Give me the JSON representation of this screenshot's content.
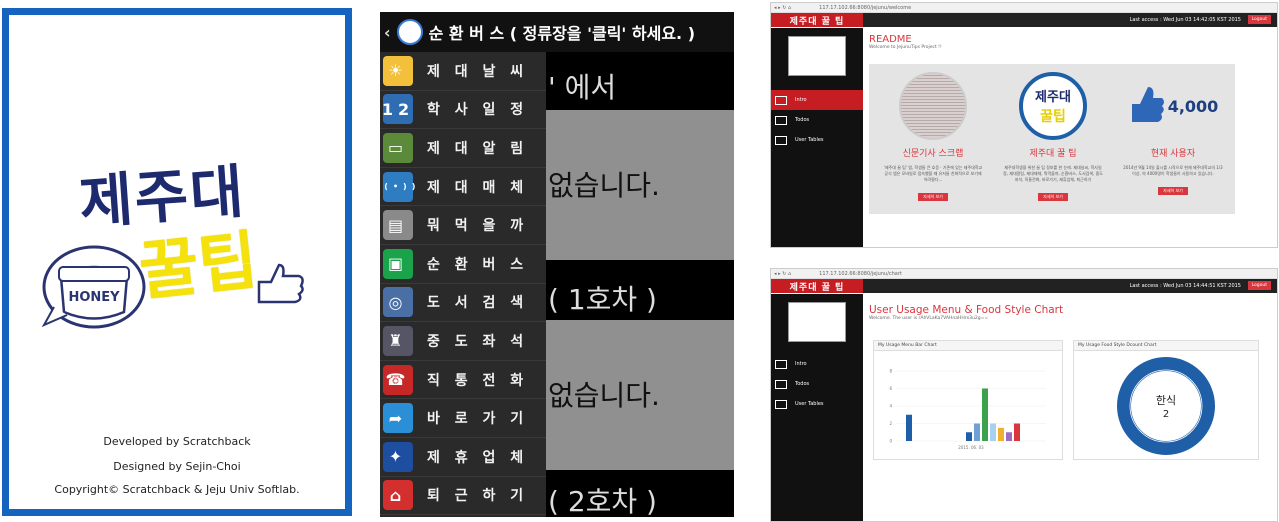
{
  "splash": {
    "title_line1": "제주대",
    "title_line2": "꿀팁",
    "pot_label": "HONEY",
    "developed_by": "Developed by Scratchback",
    "designed_by": "Designed by Sejin-Choi",
    "copyright": "Copyright© Scratchback & Jeju Univ Softlab."
  },
  "phone": {
    "back_glyph": "‹",
    "header_title": "순 환 버 스 ( 정류장을 '클릭' 하세요. )",
    "bg_texts": [
      "' 에서",
      "없습니다.",
      "( 1호차 )",
      "없습니다.",
      "( 2호차 )"
    ],
    "menu": [
      {
        "label": "제 대 날 씨",
        "icon": "weather-icon",
        "color": "#f3c03b",
        "glyph": "☀"
      },
      {
        "label": "학 사 일 정",
        "icon": "calendar-icon",
        "color": "#2f6db3",
        "glyph": "12"
      },
      {
        "label": "제 대 알 림",
        "icon": "board-icon",
        "color": "#5a8a3a",
        "glyph": "▭"
      },
      {
        "label": "제 대 매 체",
        "icon": "broadcast-icon",
        "color": "#2e7cc2",
        "glyph": "((•))"
      },
      {
        "label": "뭐 먹 을 까",
        "icon": "menu-icon",
        "color": "#8a8a8a",
        "glyph": "▤"
      },
      {
        "label": "순 환 버 스",
        "icon": "bus-icon",
        "color": "#1aa34a",
        "glyph": "▣"
      },
      {
        "label": "도 서 검 색",
        "icon": "search-icon",
        "color": "#4a6fa5",
        "glyph": "◎"
      },
      {
        "label": "중 도 좌 석",
        "icon": "chair-icon",
        "color": "#556",
        "glyph": "♜"
      },
      {
        "label": "직 통 전 화",
        "icon": "phone-icon",
        "color": "#c62828",
        "glyph": "☎"
      },
      {
        "label": "바 로 가 기",
        "icon": "shortcut-icon",
        "color": "#2a8fd6",
        "glyph": "➦"
      },
      {
        "label": "제 휴 업 체",
        "icon": "handshake-icon",
        "color": "#1e4ea0",
        "glyph": "✦"
      },
      {
        "label": "퇴 근 하 기",
        "icon": "home-icon",
        "color": "#d32f2f",
        "glyph": "⌂"
      }
    ]
  },
  "web1": {
    "url": "117.17.102.66:8080/jejunu/welcome",
    "brand": "제주대 꿀 팁",
    "last_access": "Last access : Wed Jun 03 14:42:05 KST 2015",
    "logout": "Logout",
    "nav": [
      "Intro",
      "Todos",
      "User Tables"
    ],
    "readme_title": "README",
    "readme_sub": "Welcome to JejunuTips Project !!",
    "cols": [
      {
        "heading": "신문기사 스크랩",
        "text": "'제주대 꿀 팁' 앱, 학생들 큰 호응 · 기존에 있는 제주대학교 공식 앱은 모바일로 접속했을 때 유저들 친화적으로 보기에 어려웠다...",
        "btn": "자세히 보기"
      },
      {
        "heading": "제주대 꿀 팁",
        "text": "제주대학생을 위한 꿀 팁 정보를 한 눈에. 제대날씨, 학사일정, 제대알림, 제대매체, 뭐먹을까, 순환버스, 도서검색, 중도좌석, 직통전화, 바로가기, 제휴업체, 퇴근하기",
        "btn": "자세히 보기"
      },
      {
        "heading": "현재 사용자",
        "text": "2014년 9월 14일 출시를 시작으로 현재 제주대학교의 1/3 이상, 약 4000명이 학생들이 사용하고 있습니다.",
        "btn": "자세히 보기"
      }
    ],
    "thumb_count": "4,000",
    "badge_line1": "제주대",
    "badge_line2": "꿀팁"
  },
  "web2": {
    "url": "117.17.102.66:8080/jejunu/chart",
    "brand": "제주대 꿀 팁",
    "last_access": "Last access : Wed Jun 03 14:44:51 KST 2015",
    "logout": "Logout",
    "nav": [
      "Intro",
      "Todos",
      "User Tables"
    ],
    "title": "User Usage Menu & Food Style Chart",
    "subtitle": "Welcome. The user is rAhVLaKa7VAHnaHHrx3u2g==",
    "bar_card_title": "My Usage Menu Bar Chart",
    "donut_card_title": "My Usage Food Style Dcount Chart",
    "donut_label": "한식",
    "donut_value": "2",
    "x_label": "2015. 06. 03"
  },
  "chart_data": [
    {
      "type": "bar",
      "title": "My Usage Menu Bar Chart",
      "yticks": [
        0,
        2,
        4,
        6,
        8
      ],
      "ylim": [
        0,
        8
      ],
      "x": "2015. 06. 03",
      "series": [
        {
          "values": [
            3
          ],
          "color": "#1f5fa8"
        },
        {
          "values": [
            1
          ],
          "color": "#1f5fa8"
        },
        {
          "values": [
            2
          ],
          "color": "#6fa0d8"
        },
        {
          "values": [
            6
          ],
          "color": "#3aa24a"
        },
        {
          "values": [
            2
          ],
          "color": "#a9d1ef"
        },
        {
          "values": [
            1.5
          ],
          "color": "#f0b030"
        },
        {
          "values": [
            1
          ],
          "color": "#9a6cc2"
        },
        {
          "values": [
            2
          ],
          "color": "#d9363e"
        }
      ]
    },
    {
      "type": "pie",
      "title": "My Usage Food Style Dcount Chart",
      "slices": [
        {
          "label": "한식",
          "value": 2,
          "color": "#1f5fa8"
        }
      ]
    }
  ]
}
